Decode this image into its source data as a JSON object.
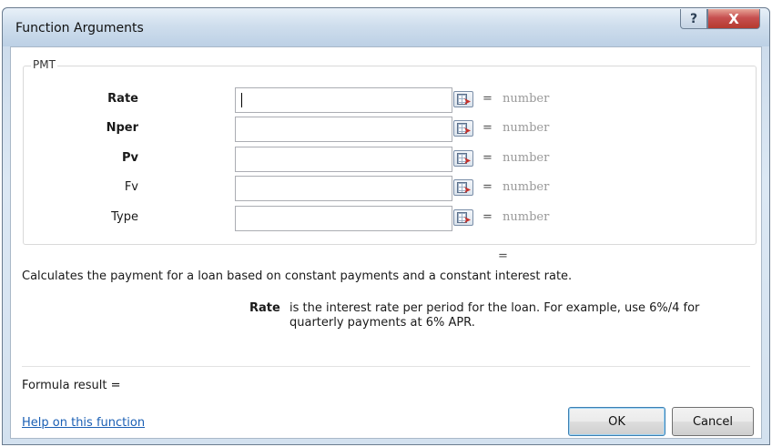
{
  "window": {
    "title": "Function Arguments",
    "help_button": "?",
    "close_button": "X"
  },
  "group": {
    "label": "PMT"
  },
  "arguments": [
    {
      "label": "Rate",
      "bold": true,
      "value": "",
      "result": "number",
      "focused": true
    },
    {
      "label": "Nper",
      "bold": true,
      "value": "",
      "result": "number",
      "focused": false
    },
    {
      "label": "Pv",
      "bold": true,
      "value": "",
      "result": "number",
      "focused": false
    },
    {
      "label": "Fv",
      "bold": false,
      "value": "",
      "result": "number",
      "focused": false
    },
    {
      "label": "Type",
      "bold": false,
      "value": "",
      "result": "number",
      "focused": false
    }
  ],
  "equals_sign": "=",
  "function_result_eq": "=",
  "description": "Calculates the payment for a loan based on constant payments and a constant interest rate.",
  "argument_help": {
    "name": "Rate",
    "text": "is the interest rate per period for the loan. For example, use 6%/4 for quarterly payments at 6% APR."
  },
  "formula_result_label": "Formula result =",
  "help_link": "Help on this function",
  "buttons": {
    "ok": "OK",
    "cancel": "Cancel"
  },
  "icons": {
    "ref_button": "collapse-dialog-icon"
  }
}
